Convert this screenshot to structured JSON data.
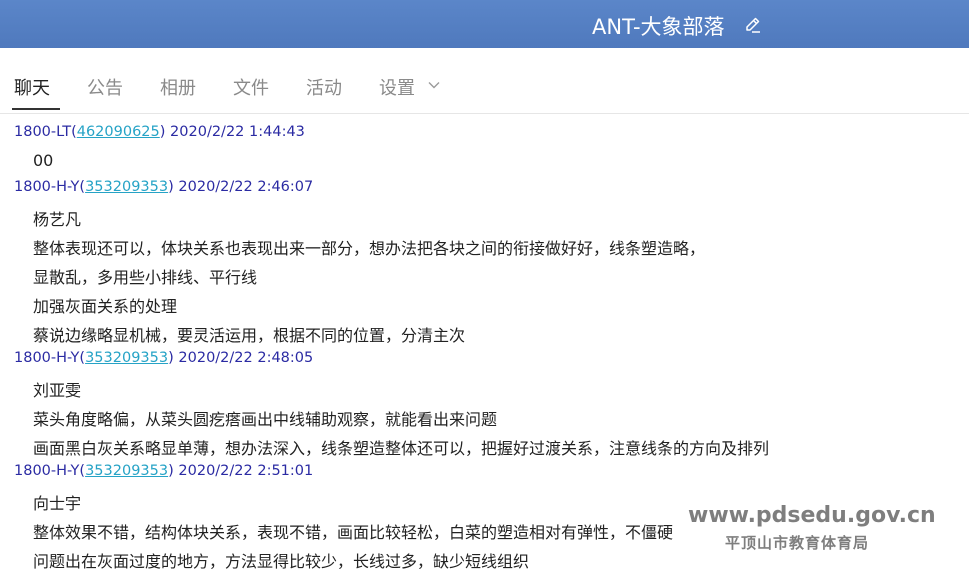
{
  "header": {
    "group_name": "ANT-大象部落"
  },
  "tabs": [
    {
      "label": "聊天"
    },
    {
      "label": "公告"
    },
    {
      "label": "相册"
    },
    {
      "label": "文件"
    },
    {
      "label": "活动"
    },
    {
      "label": "设置"
    }
  ],
  "messages": [
    {
      "sender": "1800-LT(",
      "qq": "462090625",
      "close": ")",
      "time": "2020/2/22 1:44:43",
      "lines": [
        "00"
      ]
    },
    {
      "sender": "1800-H-Y(",
      "qq": "353209353",
      "close": ")",
      "time": "2020/2/22 2:46:07",
      "lines": [
        "杨艺凡",
        "整体表现还可以，体块关系也表现出来一部分，想办法把各块之间的衔接做好好，线条塑造略，",
        "显散乱，多用些小排线、平行线",
        "加强灰面关系的处理",
        "蔡说边缘略显机械，要灵活运用，根据不同的位置，分清主次"
      ]
    },
    {
      "sender": "1800-H-Y(",
      "qq": "353209353",
      "close": ")",
      "time": "2020/2/22 2:48:05",
      "lines": [
        "刘亚雯",
        "菜头角度略偏，从菜头圆疙瘩画出中线辅助观察，就能看出来问题",
        "画面黑白灰关系略显单薄，想办法深入，线条塑造整体还可以，把握好过渡关系，注意线条的方向及排列"
      ]
    },
    {
      "sender": "1800-H-Y(",
      "qq": "353209353",
      "close": ")",
      "time": "2020/2/22 2:51:01",
      "lines": [
        "向士宇",
        "整体效果不错，结构体块关系，表现不错，画面比较轻松，白菜的塑造相对有弹性，不僵硬",
        "问题出在灰面过度的地方，方法显得比较少，长线过多，缺少短线组织"
      ]
    }
  ],
  "watermark": {
    "url": "www.pdsedu.gov.cn",
    "org": "平顶山市教育体育局"
  }
}
